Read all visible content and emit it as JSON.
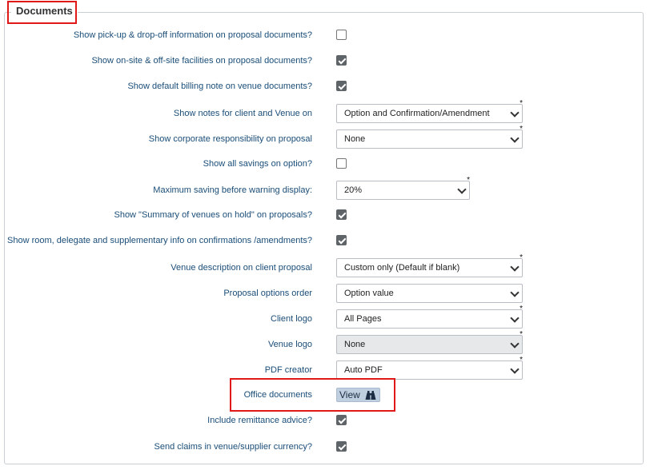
{
  "section": {
    "legend": "Documents"
  },
  "rows": [
    {
      "label": "Show pick-up & drop-off information on proposal documents?",
      "checked": false
    },
    {
      "label": "Show on-site & off-site facilities on proposal documents?",
      "checked": true
    },
    {
      "label": "Show default billing note on venue documents?",
      "checked": true
    },
    {
      "label": "Show notes for client and Venue on",
      "value": "Option and Confirmation/Amendment",
      "required": "*"
    },
    {
      "label": "Show corporate responsibility on proposal",
      "value": "None",
      "required": "*"
    },
    {
      "label": "Show all savings on option?",
      "checked": false
    },
    {
      "label": "Maximum saving before warning display:",
      "value": "20%",
      "required": "*"
    },
    {
      "label": "Show \"Summary of venues on hold\" on proposals?",
      "checked": true
    },
    {
      "label": "Show room, delegate and supplementary info on confirmations /amendments?",
      "checked": true
    },
    {
      "label": "Venue description on client proposal",
      "value": "Custom only (Default if blank)",
      "required": "*"
    },
    {
      "label": "Proposal options order",
      "value": "Option value"
    },
    {
      "label": "Client logo",
      "value": "All Pages",
      "required": "*"
    },
    {
      "label": "Venue logo",
      "value": "None",
      "required": "*",
      "disabled": true
    },
    {
      "label": "PDF creator",
      "value": "Auto PDF",
      "required": "*"
    },
    {
      "label": "Office documents",
      "button": "View",
      "icon": "binoculars-icon"
    },
    {
      "label": "Include remittance advice?",
      "checked": true
    },
    {
      "label": "Send claims in venue/supplier currency?",
      "checked": true
    }
  ],
  "colors": {
    "label": "#1a4d78",
    "highlight": "#e01818",
    "view_button": "#bfcfe0"
  }
}
